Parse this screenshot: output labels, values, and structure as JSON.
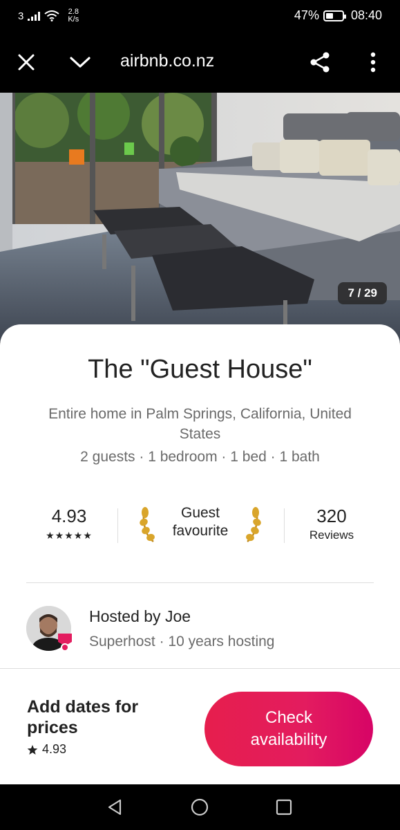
{
  "status_bar": {
    "carrier_num": "3",
    "net_speed_value": "2.8",
    "net_speed_unit": "K/s",
    "battery_percent": "47%",
    "battery_level": 0.47,
    "time": "08:40"
  },
  "browser": {
    "url": "airbnb.co.nz"
  },
  "gallery": {
    "counter": "7 / 29"
  },
  "listing": {
    "title": "The \"Guest House\"",
    "subtitle": "Entire home in Palm Springs, California, United States",
    "details": "2 guests · 1 bedroom · 1 bed · 1 bath"
  },
  "stats": {
    "rating": "4.93",
    "stars": "★★★★★",
    "badge_line1": "Guest",
    "badge_line2": "favourite",
    "reviews_count": "320",
    "reviews_label": "Reviews"
  },
  "host": {
    "name": "Hosted by Joe",
    "meta": "Superhost · 10 years hosting"
  },
  "booking": {
    "price_label": "Add dates for prices",
    "rating": "4.93",
    "button_line1": "Check",
    "button_line2": "availability"
  },
  "colors": {
    "brand": "#E31C5F",
    "text_primary": "#222222",
    "text_secondary": "#6A6A6A"
  }
}
